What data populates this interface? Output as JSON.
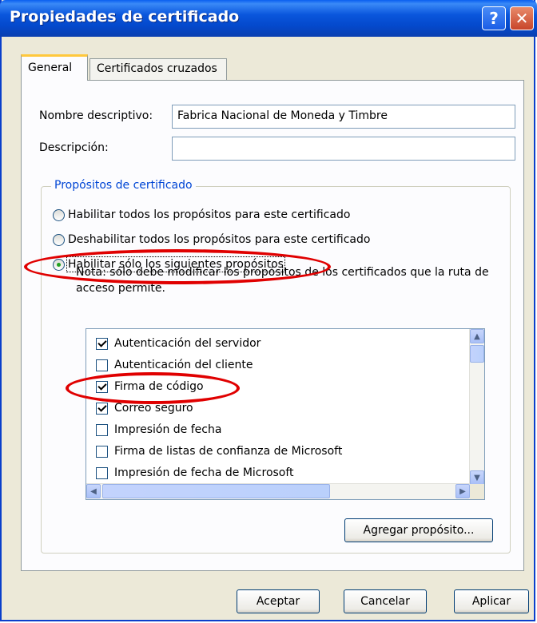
{
  "window": {
    "title": "Propiedades de certificado",
    "help_glyph": "?",
    "close_glyph": "✕"
  },
  "tabs": [
    {
      "label": "General",
      "active": true
    },
    {
      "label": "Certificados cruzados",
      "active": false
    }
  ],
  "form": {
    "friendly_name_label": "Nombre descriptivo:",
    "friendly_name_value": "Fabrica Nacional de Moneda y Timbre",
    "description_label": "Descripción:",
    "description_value": ""
  },
  "purposes": {
    "group_label": "Propósitos de certificado",
    "options": [
      {
        "label": "Habilitar todos los propósitos para este certificado",
        "checked": false
      },
      {
        "label": "Deshabilitar todos los propósitos para este certificado",
        "checked": false
      },
      {
        "label": "Habilitar sólo los siguientes propósitos",
        "checked": true
      }
    ],
    "note": "Nota: sólo debe modificar los propósitos de los certificados que la ruta de acceso permite.",
    "list": [
      {
        "label": "Autenticación del servidor",
        "checked": true
      },
      {
        "label": "Autenticación del cliente",
        "checked": false
      },
      {
        "label": "Firma de código",
        "checked": true
      },
      {
        "label": "Correo seguro",
        "checked": true
      },
      {
        "label": "Impresión de fecha",
        "checked": false
      },
      {
        "label": "Firma de listas de confianza de Microsoft",
        "checked": false
      },
      {
        "label": "Impresión de fecha de Microsoft",
        "checked": false
      }
    ],
    "add_button": "Agregar propósito..."
  },
  "footer": {
    "ok": "Aceptar",
    "cancel": "Cancelar",
    "apply": "Aplicar"
  },
  "colors": {
    "annotation": "#e00000",
    "titlebar": "#0a56dc",
    "group_label": "#0046d5"
  }
}
